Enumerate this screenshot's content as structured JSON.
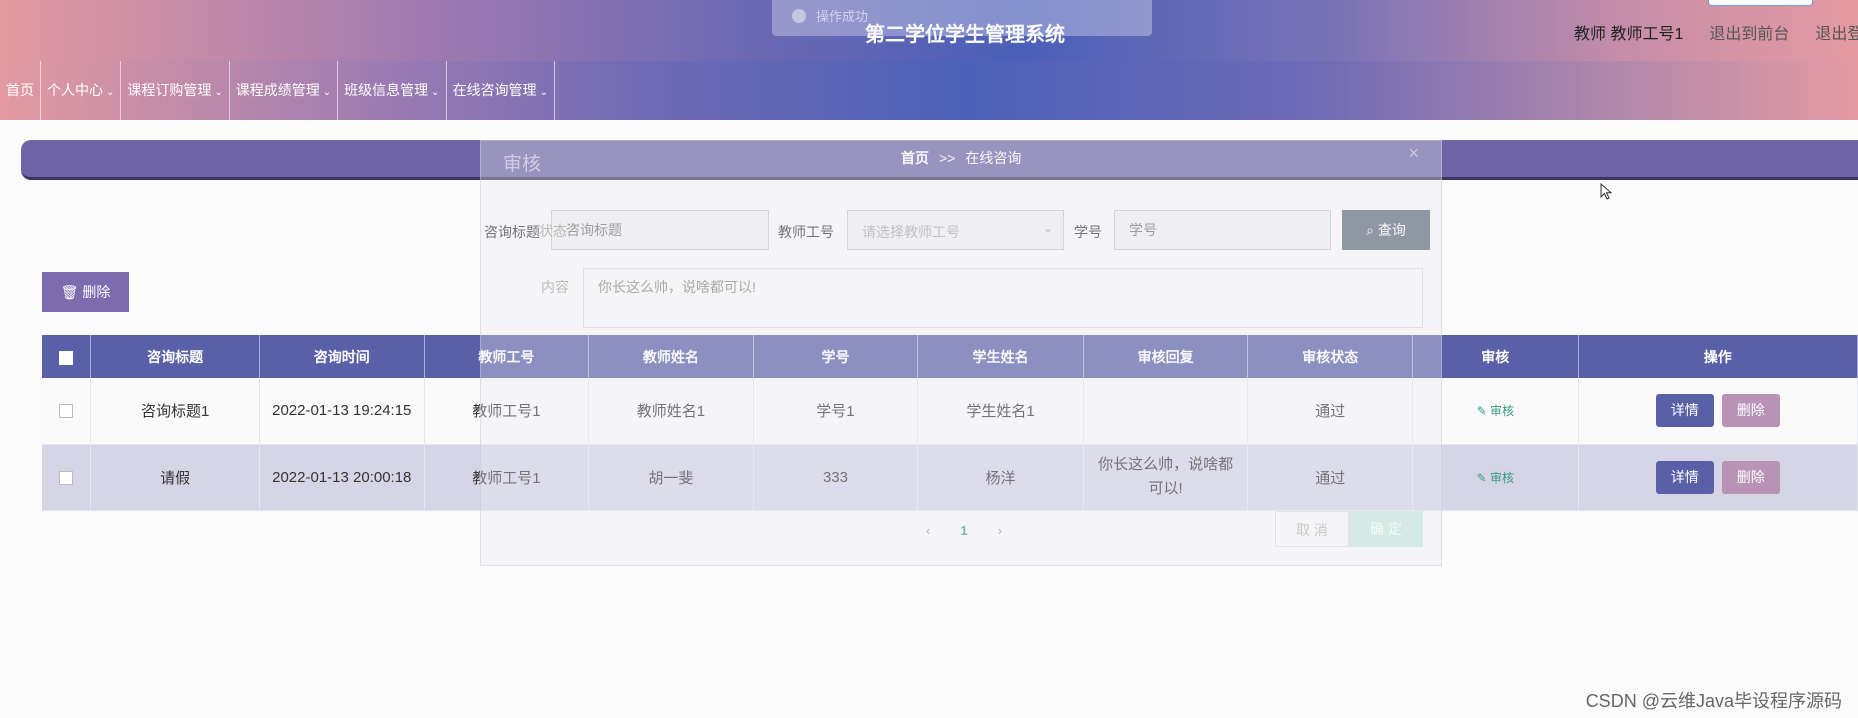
{
  "header": {
    "title": "第二学位学生管理系统",
    "user_info": "教师 教师工号1",
    "link_front": "退出到前台",
    "link_logout": "退出登"
  },
  "toast": {
    "text": "操作成功"
  },
  "nav": {
    "items": [
      {
        "label": "首页"
      },
      {
        "label": "个人中心"
      },
      {
        "label": "课程订购管理"
      },
      {
        "label": "课程成绩管理"
      },
      {
        "label": "班级信息管理"
      },
      {
        "label": "在线咨询管理"
      }
    ],
    "chevron": "⌄"
  },
  "breadcrumb": {
    "home": "首页",
    "sep": ">>",
    "current": "在线咨询"
  },
  "search": {
    "title_label": "咨询标题",
    "title_placeholder": "咨询标题",
    "teacher_label": "教师工号",
    "teacher_placeholder": "请选择教师工号",
    "student_label": "学号",
    "student_placeholder": "学号",
    "query_label": "查询"
  },
  "toolbar": {
    "delete_label": "删除"
  },
  "table": {
    "headers": [
      "咨询标题",
      "咨询时间",
      "教师工号",
      "教师姓名",
      "学号",
      "学生姓名",
      "审核回复",
      "审核状态",
      "审核",
      "操作"
    ],
    "rows": [
      {
        "title": "咨询标题1",
        "time": "2022-01-13 19:24:15",
        "teacher_no": "教师工号1",
        "teacher_name": "教师姓名1",
        "student_no": "学号1",
        "student_name": "学生姓名1",
        "reply": "",
        "status": "通过",
        "audit": "审核",
        "detail": "详情",
        "del": "删除"
      },
      {
        "title": "请假",
        "time": "2022-01-13 20:00:18",
        "teacher_no": "教师工号1",
        "teacher_name": "胡一斐",
        "student_no": "333",
        "student_name": "杨洋",
        "reply": "你长这么帅，说啥都可以!",
        "status": "通过",
        "audit": "审核",
        "detail": "详情",
        "del": "删除"
      }
    ]
  },
  "pager": {
    "prev": "‹",
    "current": "1",
    "next": "›"
  },
  "dialog": {
    "title": "审核",
    "close": "×",
    "field1_label": "状态",
    "content_label": "内容",
    "content_value": "你长这么帅，说啥都可以!",
    "cancel": "取 消",
    "ok": "确 定"
  },
  "watermark": "CSDN @云维Java毕设程序源码",
  "colors": {
    "primary": "#5a60a8",
    "accent": "#3a9a86",
    "delete": "#b893b6"
  }
}
